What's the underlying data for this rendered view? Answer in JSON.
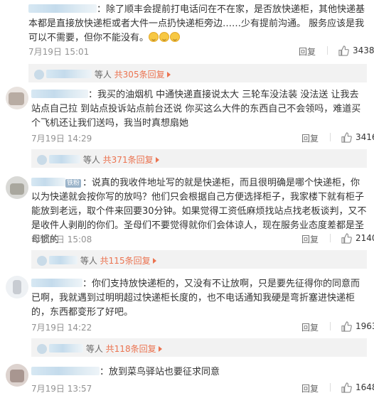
{
  "comments": [
    {
      "text": "除了顺丰会提前打电话问在不在家，是否放快递柜，其他快递基本都是直接放快递柜或者大件一点扔快递柜旁边……少有提前沟通。 服务应该是我可以不需要，但你不能没有。",
      "emoji_icon": "smile-emoji-icon",
      "time": "7月19日 15:01",
      "reply_label": "回复",
      "likes": "3438",
      "sub_prefix": "等人",
      "sub_link": "共305条回复"
    },
    {
      "text": "我买的油烟机 中通快递直接说太大 三轮车没法装 没法送 让我去站点自己拉 到站点投诉站点前台还说 你买这么大件的东西自己不会领吗，难道买个飞机还让我们送吗，我当时真想扇她",
      "time": "7月19日 14:29",
      "reply_label": "回复",
      "likes": "3416",
      "sub_prefix": "等人",
      "sub_link": "共371条回复"
    },
    {
      "badge": "铁粉",
      "text": "说真的我收件地址写的就是快递柜，而且很明确是哪个快递柜，你以为快递就会按你写的放吗？他们只会根据自己方便选择柜子，我家楼下就有柜子能放到老远，取个件来回要30分钟。如果觉得工资低麻烦找站点找老板谈判，又不是收件人剥削的你们。圣母们不要觉得就你们会体谅人，现在服务业态度差都是圣母惯的",
      "time": "7月19日 15:08",
      "reply_label": "回复",
      "likes": "2140",
      "sub_prefix": "等人",
      "sub_link": "共115条回复"
    },
    {
      "text": "你们支持放快递柜的，又没有不让放啊，只是要先征得你的同意而已啊，我就遇到过明明超过快递柜长度的，也不电话通知我硬是弯折塞进快递柜的，东西都变形了好吧。",
      "time": "7月19日 14:22",
      "reply_label": "回复",
      "likes": "1963",
      "sub_prefix": "等人",
      "sub_link": "共118条回复"
    },
    {
      "text": "放到菜鸟驿站也要征求同意",
      "time": "7月19日 13:57",
      "reply_label": "回复",
      "likes": "1648"
    }
  ]
}
